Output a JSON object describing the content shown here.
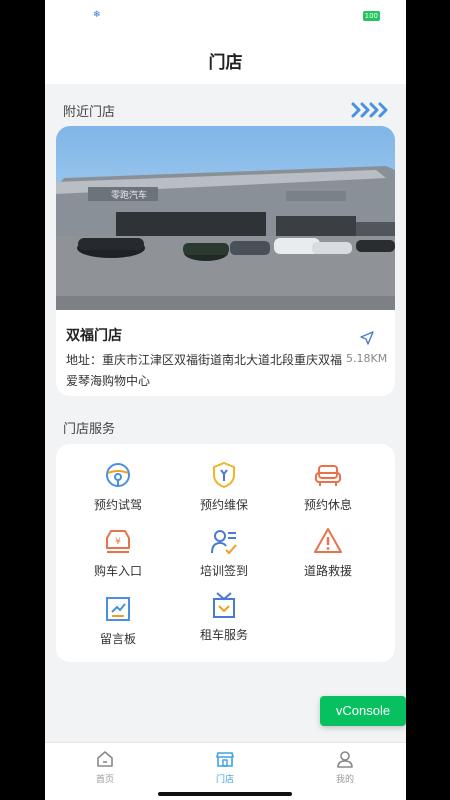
{
  "status_bar": {
    "left_icon": "snowflake-icon",
    "right_badge": "100"
  },
  "nav": {
    "title": "门店"
  },
  "nearby": {
    "section_label": "附近门店",
    "more_icon": "double-chevron-right-icon",
    "store": {
      "photo_icon": "store-photo",
      "sign_text": "零跑汽车",
      "name": "双福门店",
      "address": "地址：重庆市江津区双福街道南北大道北段重庆双福爱琴海购物中心",
      "distance": "5.18KM"
    }
  },
  "services": {
    "section_label": "门店服务",
    "items": [
      {
        "label": "预约试驾",
        "icon": "steering-wheel-icon"
      },
      {
        "label": "预约维保",
        "icon": "shield-wrench-icon"
      },
      {
        "label": "预约休息",
        "icon": "sofa-icon"
      },
      {
        "label": "购车入口",
        "icon": "car-yen-icon"
      },
      {
        "label": "培训签到",
        "icon": "user-checklist-icon"
      },
      {
        "label": "道路救援",
        "icon": "warning-triangle-icon"
      },
      {
        "label": "留言板",
        "icon": "message-board-icon"
      },
      {
        "label": "租车服务",
        "icon": "rental-bag-icon"
      }
    ]
  },
  "floating": {
    "vconsole_label": "vConsole"
  },
  "tabbar": {
    "items": [
      {
        "label": "首页",
        "icon": "home-icon",
        "active": false
      },
      {
        "label": "门店",
        "icon": "store-icon",
        "active": true
      },
      {
        "label": "我的",
        "icon": "user-icon",
        "active": false
      }
    ]
  },
  "colors": {
    "accent": "#3aa3e3",
    "blue_icon": "#4a7bd0",
    "orange_icon": "#e8734a",
    "yellow_icon": "#f0b429",
    "vconsole": "#07c160"
  }
}
